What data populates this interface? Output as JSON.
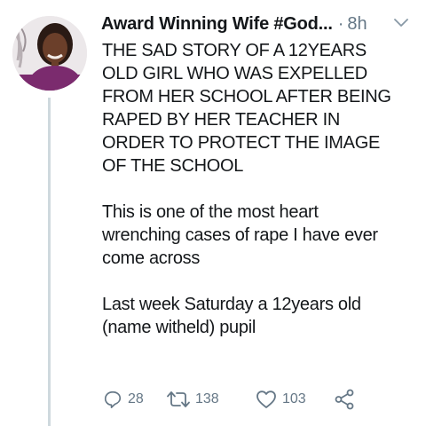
{
  "tweet": {
    "author_name": "Award Winning Wife #God...",
    "separator": "·",
    "time": "8h",
    "paragraphs": [
      "THE SAD STORY OF A 12YEARS\nOLD GIRL WHO WAS EXPELLED\nFROM HER SCHOOL AFTER BEING\nRAPED BY HER TEACHER IN\nORDER TO PROTECT THE IMAGE\nOF THE SCHOOL",
      "This is one of the most heart\nwrenching cases of rape I have ever\ncome across",
      "Last week Saturday a 12years old\n(name witheld) pupil"
    ],
    "actions": {
      "reply_icon": "reply-icon",
      "reply_count": "28",
      "retweet_icon": "retweet-icon",
      "retweet_count": "138",
      "like_icon": "heart-icon",
      "like_count": "103",
      "share_icon": "share-icon"
    }
  },
  "colors": {
    "text": "#14171a",
    "muted": "#657786",
    "thread_line": "#cfd9de",
    "background": "#ffffff"
  }
}
